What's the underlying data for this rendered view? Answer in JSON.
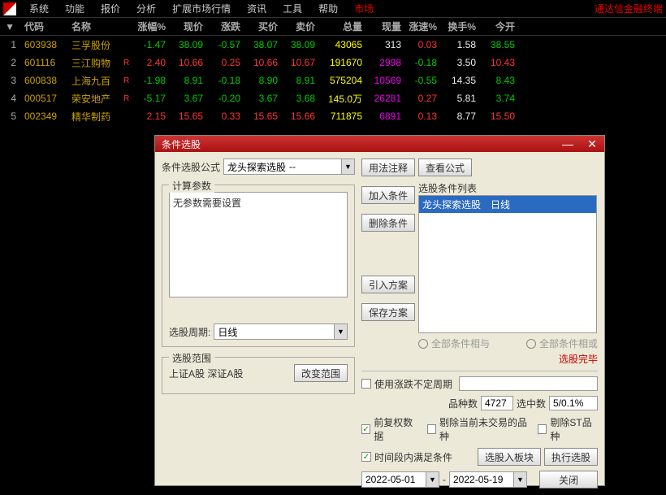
{
  "brand": "通达信金融终端",
  "menu": [
    "系统",
    "功能",
    "报价",
    "分析",
    "扩展市场行情",
    "资讯",
    "工具",
    "帮助",
    "市场"
  ],
  "menu_active_index": 8,
  "columns": [
    "代码",
    "名称",
    "涨幅%",
    "现价",
    "涨跌",
    "买价",
    "卖价",
    "总量",
    "现量",
    "涨速%",
    "换手%",
    "今开"
  ],
  "rows": [
    {
      "idx": "1",
      "code": "603938",
      "name": "三孚股份",
      "r": "",
      "chgp": "-1.47",
      "price": "38.09",
      "chg": "-0.57",
      "bid": "38.07",
      "ask": "38.09",
      "vol": "43065",
      "nvol": "313",
      "spd": "0.03",
      "turn": "1.58",
      "open": "38.55",
      "style": [
        "green",
        "green",
        "green",
        "green",
        "green",
        "yellow",
        "white",
        "red",
        "white",
        "green"
      ]
    },
    {
      "idx": "2",
      "code": "601116",
      "name": "三江购物",
      "r": "R",
      "chgp": "2.40",
      "price": "10.66",
      "chg": "0.25",
      "bid": "10.66",
      "ask": "10.67",
      "vol": "191670",
      "nvol": "2998",
      "spd": "-0.18",
      "turn": "3.50",
      "open": "10.43",
      "style": [
        "red",
        "red",
        "red",
        "red",
        "red",
        "yellow",
        "magenta",
        "green",
        "white",
        "red"
      ]
    },
    {
      "idx": "3",
      "code": "600838",
      "name": "上海九百",
      "r": "R",
      "chgp": "-1.98",
      "price": "8.91",
      "chg": "-0.18",
      "bid": "8.90",
      "ask": "8.91",
      "vol": "575204",
      "nvol": "10569",
      "spd": "-0.55",
      "turn": "14.35",
      "open": "8.43",
      "style": [
        "green",
        "green",
        "green",
        "green",
        "green",
        "yellow",
        "magenta",
        "green",
        "white",
        "green"
      ]
    },
    {
      "idx": "4",
      "code": "000517",
      "name": "荣安地产",
      "r": "R",
      "chgp": "-5.17",
      "price": "3.67",
      "chg": "-0.20",
      "bid": "3.67",
      "ask": "3.68",
      "vol": "145.0万",
      "nvol": "26281",
      "spd": "0.27",
      "turn": "5.81",
      "open": "3.74",
      "style": [
        "green",
        "green",
        "green",
        "green",
        "green",
        "yellow",
        "magenta",
        "red",
        "white",
        "green"
      ]
    },
    {
      "idx": "5",
      "code": "002349",
      "name": "精华制药",
      "r": "",
      "chgp": "2.15",
      "price": "15.65",
      "chg": "0.33",
      "bid": "15.65",
      "ask": "15.66",
      "vol": "711875",
      "nvol": "6891",
      "spd": "0.13",
      "turn": "8.77",
      "open": "15.50",
      "style": [
        "red",
        "red",
        "red",
        "red",
        "red",
        "yellow",
        "magenta",
        "red",
        "white",
        "red"
      ]
    }
  ],
  "dialog": {
    "title": "条件选股",
    "formula_label": "条件选股公式",
    "formula_value": "龙头探索选股",
    "usage_btn": "用法注释",
    "view_btn": "查看公式",
    "calc_legend": "计算参数",
    "no_params": "无参数需要设置",
    "period_label": "选股周期:",
    "period_value": "日线",
    "range_legend": "选股范围",
    "range_value": "上证A股 深证A股",
    "change_range_btn": "改变范围",
    "list_legend": "选股条件列表",
    "add_btn": "加入条件",
    "del_btn": "删除条件",
    "import_btn": "引入方案",
    "save_btn": "保存方案",
    "list_item_formula": "龙头探索选股",
    "list_item_period": "日线",
    "radio_and": "全部条件相与",
    "radio_or": "全部条件相或",
    "done_text": "选股完毕",
    "use_var_period": "使用涨跌不定周期",
    "stock_count_label": "品种数",
    "stock_count": "4727",
    "selected_label": "选中数",
    "selected_value": "5/0.1%",
    "fq_check": "前复权数据",
    "no_trade_check": "剔除当前未交易的品种",
    "no_st_check": "剔除ST品种",
    "time_check": "时间段内满足条件",
    "date_from": "2022-05-01",
    "date_to": "2022-05-19",
    "to_block_btn": "选股入板块",
    "run_btn": "执行选股",
    "close_btn": "关闭",
    "dash": "--",
    "sep": "-"
  }
}
